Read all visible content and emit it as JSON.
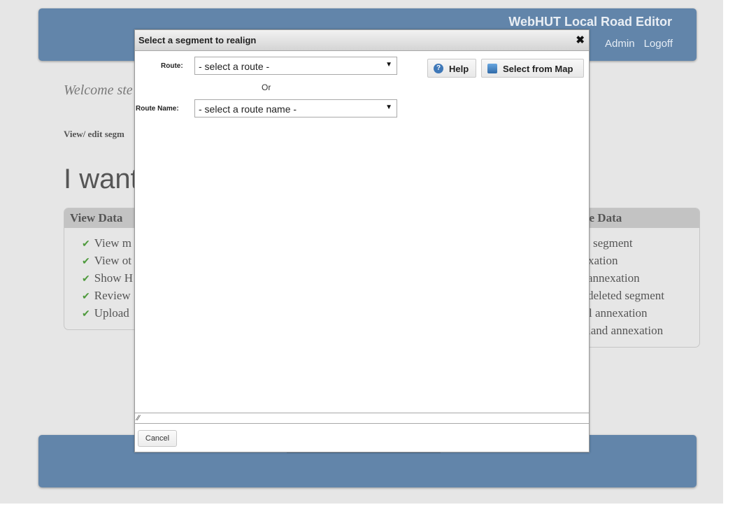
{
  "header": {
    "app_title": "WebHUT Local Road Editor",
    "nav": [
      "Admin",
      "Logoff"
    ]
  },
  "background": {
    "welcome_text": "Welcome ste",
    "view_edit_text": "View/ edit segm",
    "heading": "I want"
  },
  "left_panel": {
    "title": "View Data",
    "items": [
      "View m",
      "View ot",
      "Show H",
      "Review",
      "Upload"
    ]
  },
  "right_panel": {
    "title": "ve Data",
    "items": [
      "segment",
      "xation",
      "annexation",
      "deleted segment",
      "l annexation",
      "land annexation"
    ]
  },
  "dialog": {
    "title": "Select a segment to realign",
    "route_label": "Route:",
    "route_value": "- select a route -",
    "or_text": "Or",
    "route_name_label": "Route Name:",
    "route_name_value": "- select a route name -",
    "help_label": "Help",
    "select_map_label": "Select from Map",
    "cancel_label": "Cancel"
  },
  "colors": {
    "header_bg": "#6285aa",
    "page_bg": "#e6e6e6",
    "check": "#4e9a3c"
  }
}
